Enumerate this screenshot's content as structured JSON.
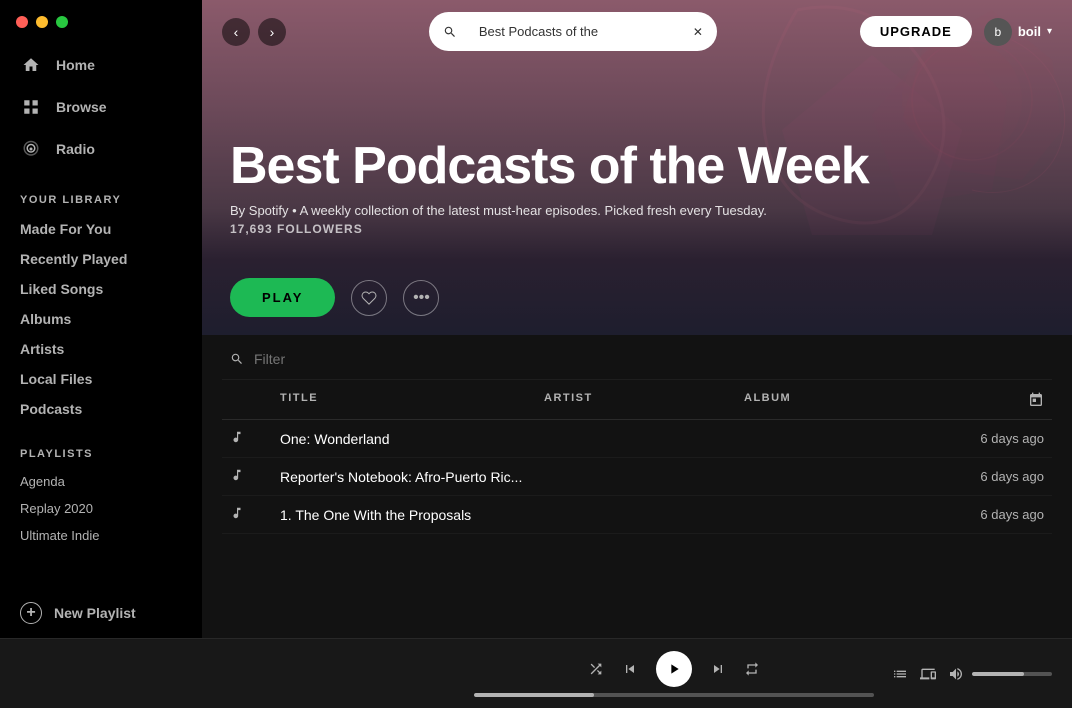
{
  "window": {
    "dots": [
      "red",
      "yellow",
      "green"
    ]
  },
  "sidebar": {
    "nav_items": [
      {
        "id": "home",
        "label": "Home",
        "icon": "home"
      },
      {
        "id": "browse",
        "label": "Browse",
        "icon": "browse"
      },
      {
        "id": "radio",
        "label": "Radio",
        "icon": "radio"
      }
    ],
    "your_library_label": "Your Library",
    "library_items": [
      {
        "id": "made-for-you",
        "label": "Made For You"
      },
      {
        "id": "recently-played",
        "label": "Recently Played"
      },
      {
        "id": "liked-songs",
        "label": "Liked Songs"
      },
      {
        "id": "albums",
        "label": "Albums"
      },
      {
        "id": "artists",
        "label": "Artists"
      },
      {
        "id": "local-files",
        "label": "Local Files"
      },
      {
        "id": "podcasts",
        "label": "Podcasts"
      }
    ],
    "playlists_label": "Playlists",
    "playlists": [
      {
        "id": "agenda",
        "label": "Agenda"
      },
      {
        "id": "replay-2020",
        "label": "Replay 2020"
      },
      {
        "id": "ultimate-indie",
        "label": "Ultimate Indie"
      }
    ],
    "new_playlist_label": "New Playlist"
  },
  "topbar": {
    "back_label": "‹",
    "forward_label": "›",
    "search_value": "Best Podcasts of the",
    "search_placeholder": "Search",
    "upgrade_label": "UPGRADE",
    "user_name": "boil",
    "user_initial": "b"
  },
  "hero": {
    "title": "Best Podcasts of the Week",
    "subtitle": "By Spotify • A weekly collection of the latest must-hear episodes. Picked fresh every Tuesday.",
    "followers": "17,693 FOLLOWERS",
    "play_label": "PLAY",
    "like_label": "♡",
    "more_label": "•••"
  },
  "tracklist": {
    "filter_placeholder": "Filter",
    "columns": {
      "num": "#",
      "title": "TITLE",
      "artist": "ARTIST",
      "album": "ALBUM",
      "date_icon": "📅"
    },
    "tracks": [
      {
        "id": 1,
        "title": "One: Wonderland",
        "artist": "",
        "album": "",
        "date": "6 days ago"
      },
      {
        "id": 2,
        "title": "Reporter's Notebook: Afro-Puerto Ric...",
        "artist": "",
        "album": "",
        "date": "6 days ago"
      },
      {
        "id": 3,
        "title": "1. The One With the Proposals",
        "artist": "",
        "album": "",
        "date": "6 days ago"
      }
    ]
  },
  "player": {
    "shuffle_icon": "⇄",
    "prev_icon": "⏮",
    "play_icon": "▶",
    "next_icon": "⏭",
    "repeat_icon": "↻",
    "queue_icon": "≡",
    "devices_icon": "⊡",
    "volume_icon": "🔊",
    "progress_percent": 30,
    "volume_percent": 65
  }
}
